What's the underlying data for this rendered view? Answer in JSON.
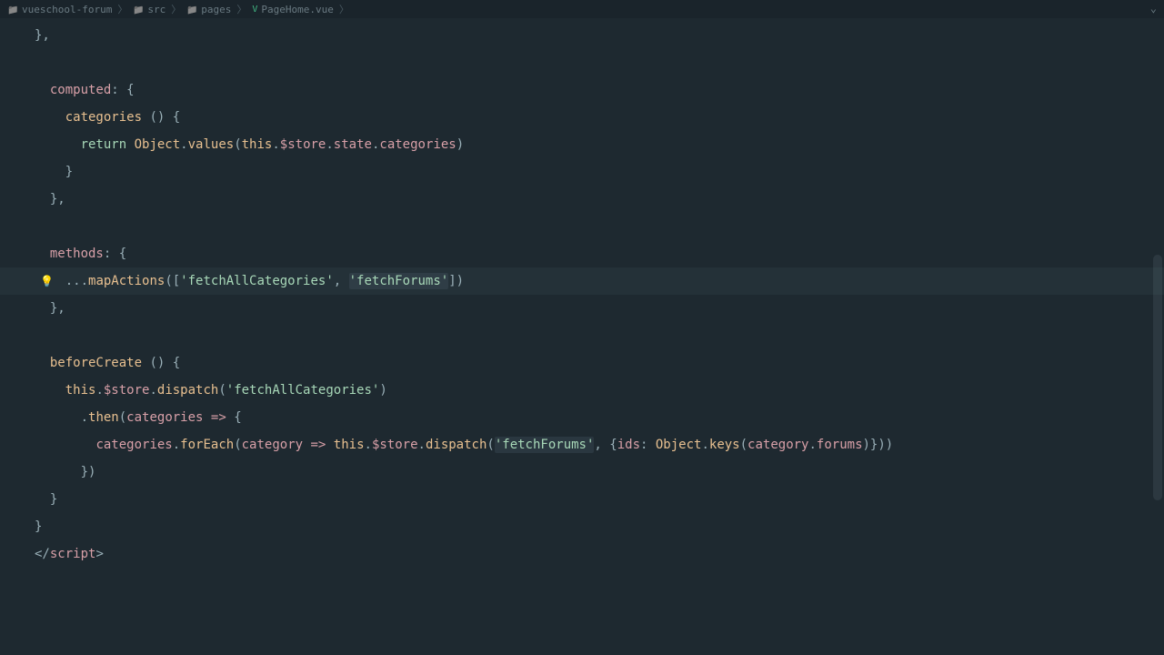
{
  "breadcrumb": {
    "items": [
      {
        "label": "vueschool-forum",
        "type": "folder"
      },
      {
        "label": "src",
        "type": "folder"
      },
      {
        "label": "pages",
        "type": "folder"
      },
      {
        "label": "PageHome.vue",
        "type": "vue"
      }
    ]
  },
  "code": {
    "line0": "},",
    "computed_kw": "computed",
    "categories_method": "categories",
    "return_kw": "return",
    "object_cls": "Object",
    "values_fn": "values",
    "this_kw": "this",
    "store": "$store",
    "state": "state",
    "categories_prop": "categories",
    "methods_kw": "methods",
    "spread": "...",
    "mapActions": "mapActions",
    "str_fetchAllCategories": "'fetchAllCategories'",
    "str_fetchForums": "'fetchForums'",
    "beforeCreate": "beforeCreate",
    "dispatch": "dispatch",
    "then": "then",
    "categories_param": "categories",
    "forEach": "forEach",
    "category_param": "category",
    "str_fetchForums2": "'fetchForums'",
    "ids_key": "ids",
    "keys_fn": "keys",
    "forums": "forums",
    "close_script_open": "</",
    "close_script_name": "script",
    "close_script_end": ">"
  }
}
